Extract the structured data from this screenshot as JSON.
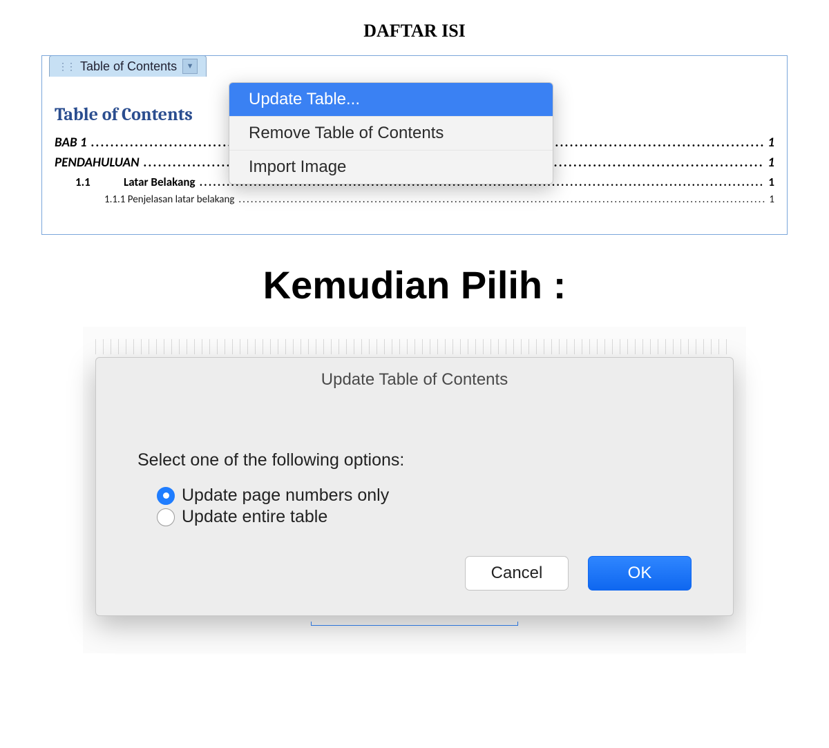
{
  "page_title": "DAFTAR ISI",
  "toc_tab": {
    "label": "Table of Contents"
  },
  "toc_heading": "Table of Contents",
  "toc_entries": [
    {
      "label": "BAB 1",
      "page": "1"
    },
    {
      "label": "PENDAHULUAN",
      "page": "1"
    }
  ],
  "toc_sub_entry": {
    "num": "1.1",
    "label": "Latar Belakang",
    "page": "1"
  },
  "toc_sub2_entry": {
    "num": "1.1.1",
    "label": "Penjelasan latar belakang",
    "page": "1"
  },
  "context_menu": {
    "items": [
      {
        "label": "Update Table...",
        "selected": true
      },
      {
        "label": "Remove Table of Contents",
        "selected": false
      },
      {
        "label": "Import Image",
        "selected": false
      }
    ]
  },
  "instruction_text": "Kemudian Pilih :",
  "dialog": {
    "title": "Update Table of Contents",
    "prompt": "Select one of the following options:",
    "options": [
      {
        "label": "Update page numbers only",
        "checked": true
      },
      {
        "label": "Update entire table",
        "checked": false
      }
    ],
    "cancel_label": "Cancel",
    "ok_label": "OK"
  }
}
